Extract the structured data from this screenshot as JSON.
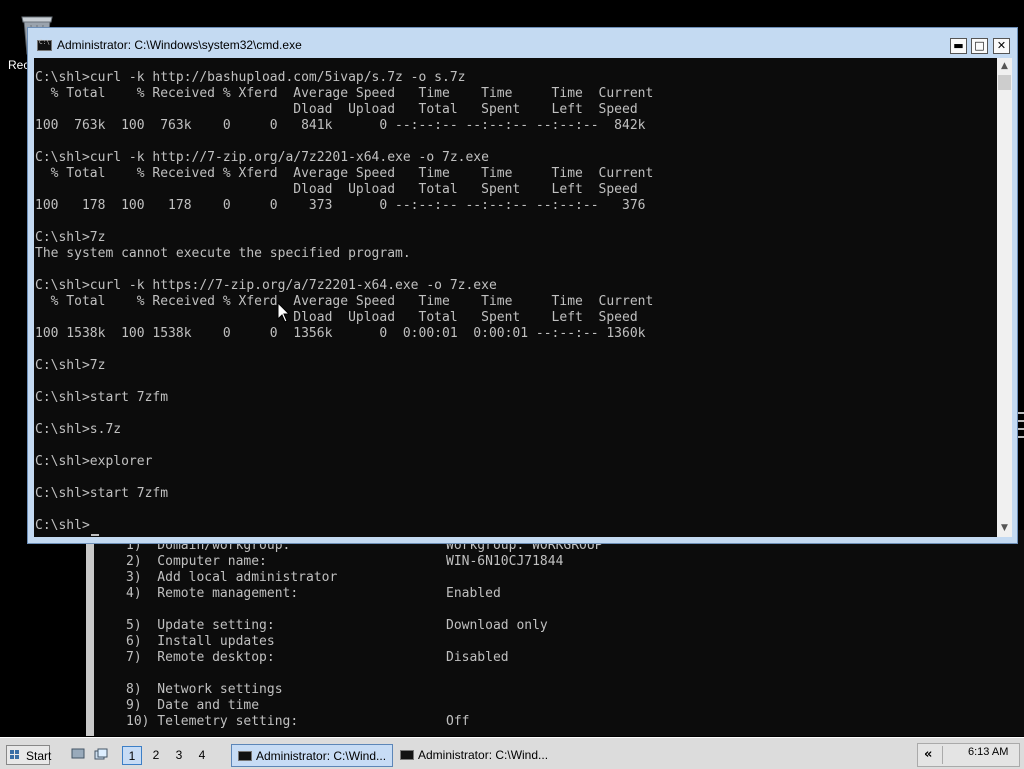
{
  "desktop": {
    "recycle_bin_label": "Rec"
  },
  "cmd_window": {
    "title": "Administrator: C:\\Windows\\system32\\cmd.exe",
    "minimize": "▬",
    "maximize": "□",
    "close": "✕",
    "lines": [
      "C:\\shl>curl -k http://bashupload.com/5ivap/s.7z -o s.7z",
      "  % Total    % Received % Xferd  Average Speed   Time    Time     Time  Current",
      "                                 Dload  Upload   Total   Spent    Left  Speed",
      "100  763k  100  763k    0     0   841k      0 --:--:-- --:--:-- --:--:--  842k",
      "",
      "C:\\shl>curl -k http://7-zip.org/a/7z2201-x64.exe -o 7z.exe",
      "  % Total    % Received % Xferd  Average Speed   Time    Time     Time  Current",
      "                                 Dload  Upload   Total   Spent    Left  Speed",
      "100   178  100   178    0     0    373      0 --:--:-- --:--:-- --:--:--   376",
      "",
      "C:\\shl>7z",
      "The system cannot execute the specified program.",
      "",
      "C:\\shl>curl -k https://7-zip.org/a/7z2201-x64.exe -o 7z.exe",
      "  % Total    % Received % Xferd  Average Speed   Time    Time     Time  Current",
      "                                 Dload  Upload   Total   Spent    Left  Speed",
      "100 1538k  100 1538k    0     0  1356k      0  0:00:01  0:00:01 --:--:-- 1360k",
      "",
      "C:\\shl>7z",
      "",
      "C:\\shl>start 7zfm",
      "",
      "C:\\shl>s.7z",
      "",
      "C:\\shl>explorer",
      "",
      "C:\\shl>start 7zfm",
      "",
      "C:\\shl>"
    ]
  },
  "sconfig_window": {
    "items": [
      {
        "label": "1)  Domain/workgroup:",
        "value": "Workgroup: WORKGROUP"
      },
      {
        "label": "2)  Computer name:",
        "value": "WIN-6N10CJ71844"
      },
      {
        "label": "3)  Add local administrator",
        "value": ""
      },
      {
        "label": "4)  Remote management:",
        "value": "Enabled"
      },
      {
        "label": "",
        "value": ""
      },
      {
        "label": "5)  Update setting:",
        "value": "Download only"
      },
      {
        "label": "6)  Install updates",
        "value": ""
      },
      {
        "label": "7)  Remote desktop:",
        "value": "Disabled"
      },
      {
        "label": "",
        "value": ""
      },
      {
        "label": "8)  Network settings",
        "value": ""
      },
      {
        "label": "9)  Date and time",
        "value": ""
      },
      {
        "label": "10) Telemetry setting:",
        "value": "Off"
      }
    ]
  },
  "taskbar": {
    "start_label": "Start",
    "pagers": [
      "1",
      "2",
      "3",
      "4"
    ],
    "active_pager": "1",
    "tasks": [
      {
        "label": "Administrator: C:\\Wind...",
        "active": true
      },
      {
        "label": "Administrator: C:\\Wind...",
        "active": false
      }
    ],
    "tray_chevron": "«",
    "clock": "6:13 AM"
  },
  "colors": {
    "console_bg": "#0c0c0c",
    "console_text": "#c0c0c0",
    "window_frame": "#c4daf2",
    "taskbar_bg": "#dcdcdc",
    "active_highlight": "#c7dcf5"
  }
}
